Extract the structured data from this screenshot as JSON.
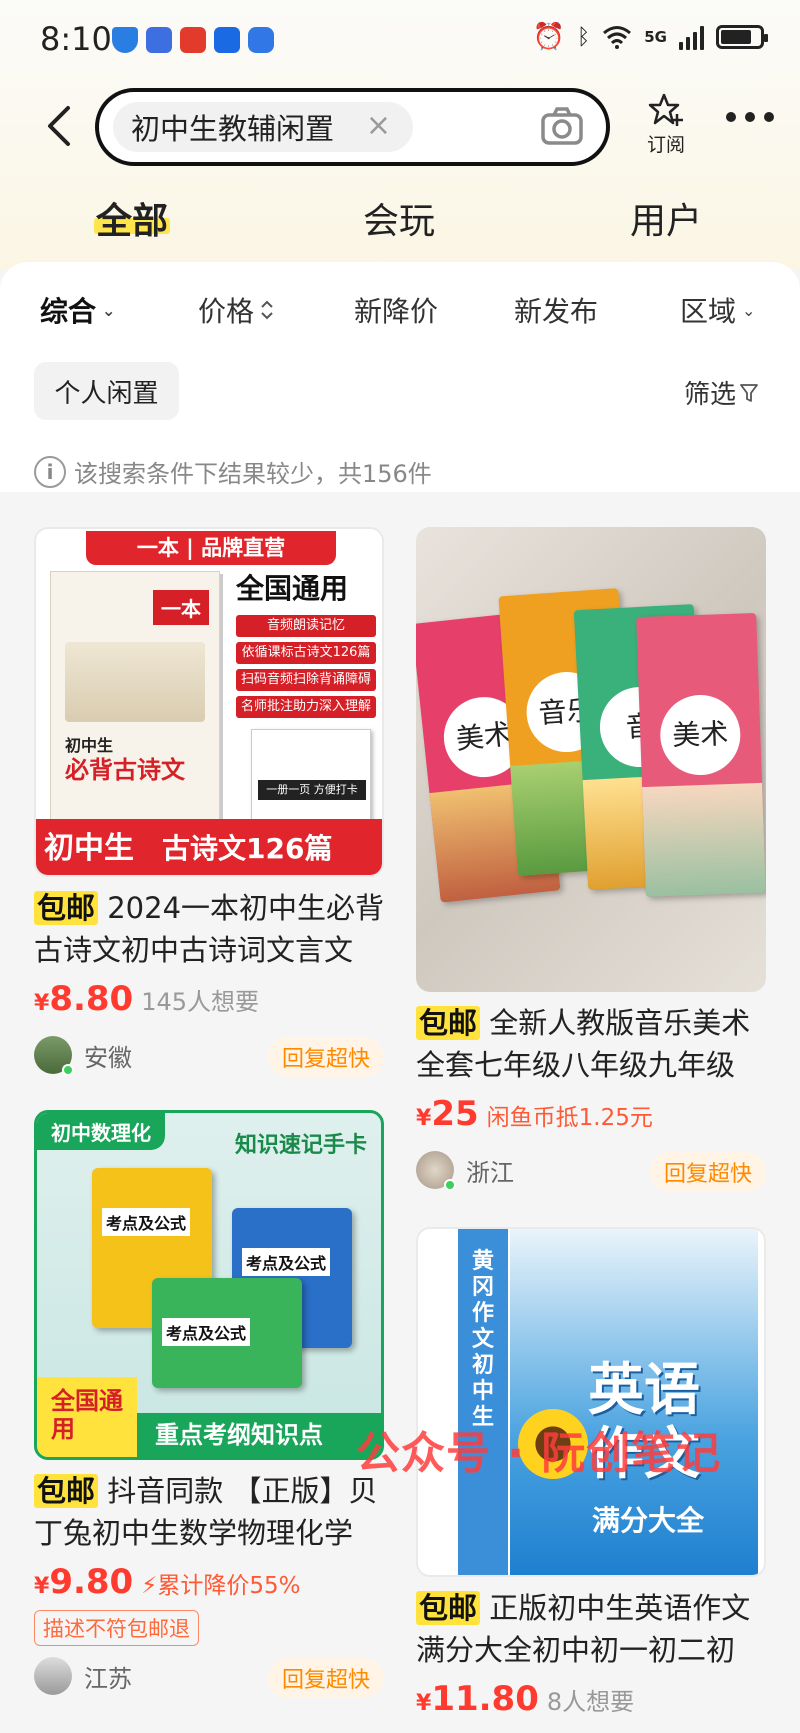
{
  "status_bar": {
    "time": "8:10",
    "network": "5G"
  },
  "header": {
    "search_query": "初中生教辅闲置",
    "clear_symbol": "×",
    "subscribe_label": "订阅"
  },
  "main_tabs": [
    {
      "label": "全部",
      "active": true
    },
    {
      "label": "会玩",
      "active": false
    },
    {
      "label": "用户",
      "active": false
    }
  ],
  "sort_bar": [
    {
      "label": "综合",
      "icon": "chevron-down-icon"
    },
    {
      "label": "价格",
      "icon": "sort-icon"
    },
    {
      "label": "新降价"
    },
    {
      "label": "新发布"
    },
    {
      "label": "区域",
      "icon": "chevron-down-icon"
    }
  ],
  "filters": {
    "personal_tag": "个人闲置",
    "filter_label": "筛选"
  },
  "notice": {
    "icon": "i",
    "text": "该搜索条件下结果较少，共156件"
  },
  "cards": [
    {
      "badge": "包邮",
      "title": "2024一本初中生必背古诗文初中古诗词文言文",
      "price_symbol": "¥",
      "price": "8.80",
      "extra": "145人想要",
      "location": "安徽",
      "reply_tag": "回复超快",
      "image": {
        "top_ribbon": "一本 | 品牌直营",
        "logo": "一本",
        "main_text": "全国通用",
        "features": [
          "音频朗读记忆",
          "依循课标古诗文126篇",
          "扫码音频扫除背诵障碍",
          "名师批注助力深入理解"
        ],
        "book_small": "初中生",
        "book_big": "必背古诗文",
        "mini_label": "一册一页 方便打卡",
        "ribbon_left": "初中生",
        "ribbon_right": "古诗文126篇"
      }
    },
    {
      "badge": "包邮",
      "title": "全新人教版音乐美术全套七年级八年级九年级",
      "price_symbol": "¥",
      "price": "25",
      "extra": "闲鱼币抵1.25元",
      "location": "浙江",
      "reply_tag": "回复超快",
      "image": {
        "books": [
          "美术",
          "音乐",
          "音",
          "美术"
        ]
      }
    },
    {
      "badge": "包邮",
      "title": "抖音同款 【正版】贝丁兔初中生数学物理化学",
      "price_symbol": "¥",
      "price": "9.80",
      "extra": "累计降价55%",
      "refund_tag": "描述不符包邮退",
      "location": "江苏",
      "reply_tag": "回复超快",
      "image": {
        "top_left": "初中数理化",
        "top_right": "知识速记手卡",
        "box_label": "考点及公式",
        "corner": "全国通用",
        "bottom": "重点考纲知识点"
      }
    },
    {
      "badge": "包邮",
      "title": "正版初中生英语作文满分大全初中初一初二初",
      "price_symbol": "¥",
      "price": "11.80",
      "extra": "8人想要",
      "image": {
        "spine": "黄冈作文初中生",
        "title": "英语作文",
        "subtitle": "满分大全"
      }
    }
  ],
  "watermark": "公众号 · 阮创笔记",
  "colors": {
    "accent_yellow": "#ffe33c",
    "price_red": "#ff3b30",
    "reply_orange": "#ff8a00"
  }
}
